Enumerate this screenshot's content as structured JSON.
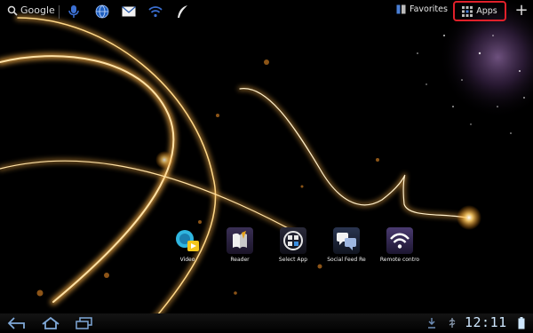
{
  "search": {
    "label": "Google",
    "icon": "search-icon"
  },
  "quick_icons": [
    {
      "name": "voice-search-icon"
    },
    {
      "name": "browser-icon"
    },
    {
      "name": "email-icon"
    },
    {
      "name": "wifi-icon"
    },
    {
      "name": "quill-icon"
    }
  ],
  "topbar": {
    "favorites_label": "Favorites",
    "apps_label": "Apps",
    "add_label": "+"
  },
  "shortcuts": [
    {
      "label": "Video",
      "icon": "video-icon"
    },
    {
      "label": "Reader",
      "icon": "reader-icon"
    },
    {
      "label": "Select App",
      "icon": "select-app-icon"
    },
    {
      "label": "Social Feed Re",
      "icon": "social-feed-icon"
    },
    {
      "label": "Remote contro",
      "icon": "remote-control-icon"
    }
  ],
  "system_bar": {
    "clock": "12:11"
  },
  "colors": {
    "highlight": "#e0202a",
    "accent": "#33b5e5",
    "streak": "#ffb347"
  }
}
